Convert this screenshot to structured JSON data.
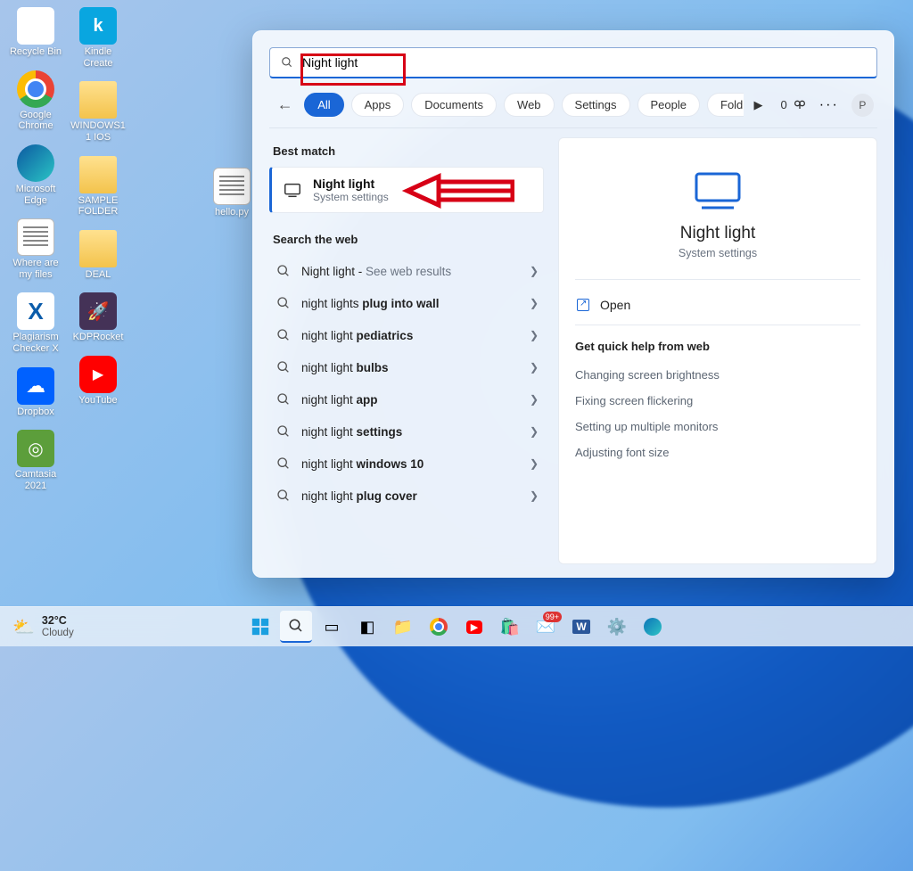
{
  "desktop": {
    "col1": [
      {
        "label": "Recycle Bin",
        "cls": "recycle"
      },
      {
        "label": "Google Chrome",
        "cls": "chrome"
      },
      {
        "label": "Microsoft Edge",
        "cls": "edge"
      },
      {
        "label": "Where are my files",
        "cls": "txt"
      },
      {
        "label": "Plagiarism Checker X",
        "cls": "xicon"
      },
      {
        "label": "Dropbox",
        "cls": "dropbox"
      },
      {
        "label": "Camtasia 2021",
        "cls": "camtasia"
      }
    ],
    "col2": [
      {
        "label": "Kindle Create",
        "cls": "kindle",
        "letter": "k"
      },
      {
        "label": "WINDOWS11 IOS",
        "cls": "folder"
      },
      {
        "label": "SAMPLE FOLDER",
        "cls": "folder"
      },
      {
        "label": "DEAL",
        "cls": "folder"
      },
      {
        "label": "KDPRocket",
        "cls": "rocket"
      },
      {
        "label": "YouTube",
        "cls": "youtube"
      }
    ],
    "col3": [
      {
        "label": "hello.py",
        "cls": "txt"
      }
    ]
  },
  "search": {
    "query": "Night light",
    "filters": [
      "All",
      "Apps",
      "Documents",
      "Web",
      "Settings",
      "People",
      "Folders"
    ],
    "active_filter": 0,
    "rewards_points": "0",
    "avatar_initial": "P",
    "best_match_section": "Best match",
    "best_match": {
      "title": "Night light",
      "subtitle": "System settings"
    },
    "web_section": "Search the web",
    "web_results": [
      {
        "prefix": "Night light",
        "suffix": " - ",
        "dim": "See web results",
        "bold": ""
      },
      {
        "prefix": "night lights ",
        "suffix": "",
        "dim": "",
        "bold": "plug into wall"
      },
      {
        "prefix": "night light ",
        "suffix": "",
        "dim": "",
        "bold": "pediatrics"
      },
      {
        "prefix": "night light ",
        "suffix": "",
        "dim": "",
        "bold": "bulbs"
      },
      {
        "prefix": "night light ",
        "suffix": "",
        "dim": "",
        "bold": "app"
      },
      {
        "prefix": "night light ",
        "suffix": "",
        "dim": "",
        "bold": "settings"
      },
      {
        "prefix": "night light ",
        "suffix": "",
        "dim": "",
        "bold": "windows 10"
      },
      {
        "prefix": "night light ",
        "suffix": "",
        "dim": "",
        "bold": "plug cover"
      }
    ],
    "detail": {
      "title": "Night light",
      "subtitle": "System settings",
      "open_label": "Open",
      "quick_title": "Get quick help from web",
      "quick_links": [
        "Changing screen brightness",
        "Fixing screen flickering",
        "Setting up multiple monitors",
        "Adjusting font size"
      ]
    }
  },
  "taskbar": {
    "temp": "32°C",
    "condition": "Cloudy",
    "badge": "99+"
  }
}
